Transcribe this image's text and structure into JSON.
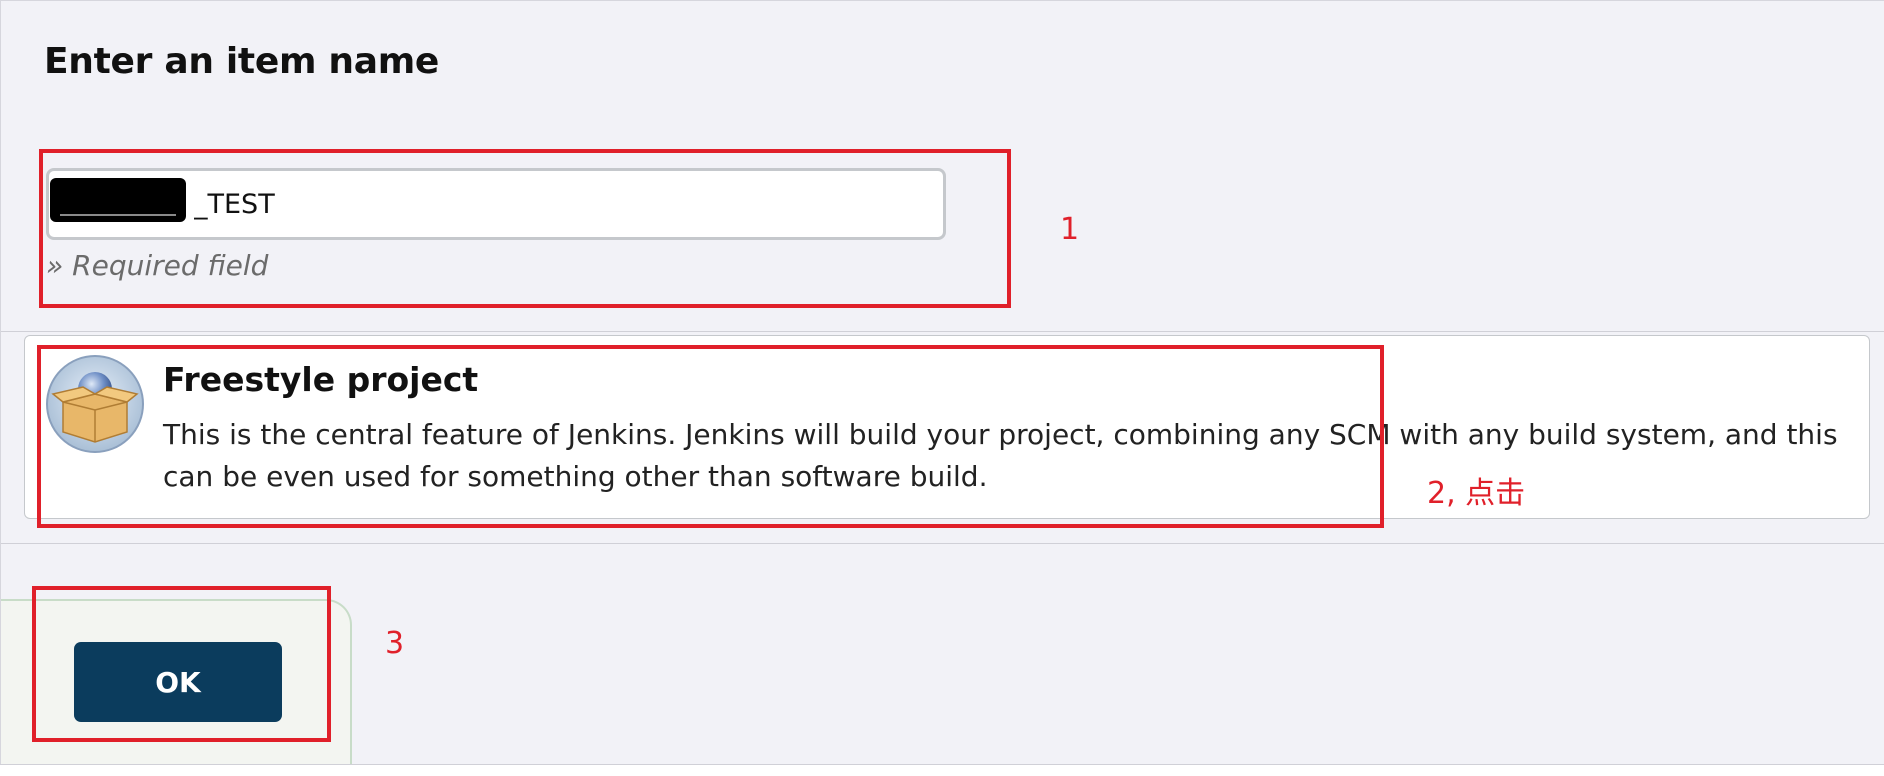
{
  "page": {
    "heading": "Enter an item name"
  },
  "name_field": {
    "value": "_TEST",
    "redacted": true,
    "required_note": "» Required field"
  },
  "item_types": [
    {
      "title": "Freestyle project",
      "description": "This is the central feature of Jenkins. Jenkins will build your project, combining any SCM with any build system, and this can be even used for something other than software build.",
      "icon": "freestyle-project-box-icon"
    }
  ],
  "actions": {
    "ok_label": "OK"
  },
  "annotations": {
    "step1": "1",
    "step2": "2, 点击",
    "step3": "3",
    "color": "#e0202a"
  },
  "colors": {
    "background": "#f2f2f7",
    "ok_button": "#0b3c5d",
    "annotation": "#e0202a"
  }
}
